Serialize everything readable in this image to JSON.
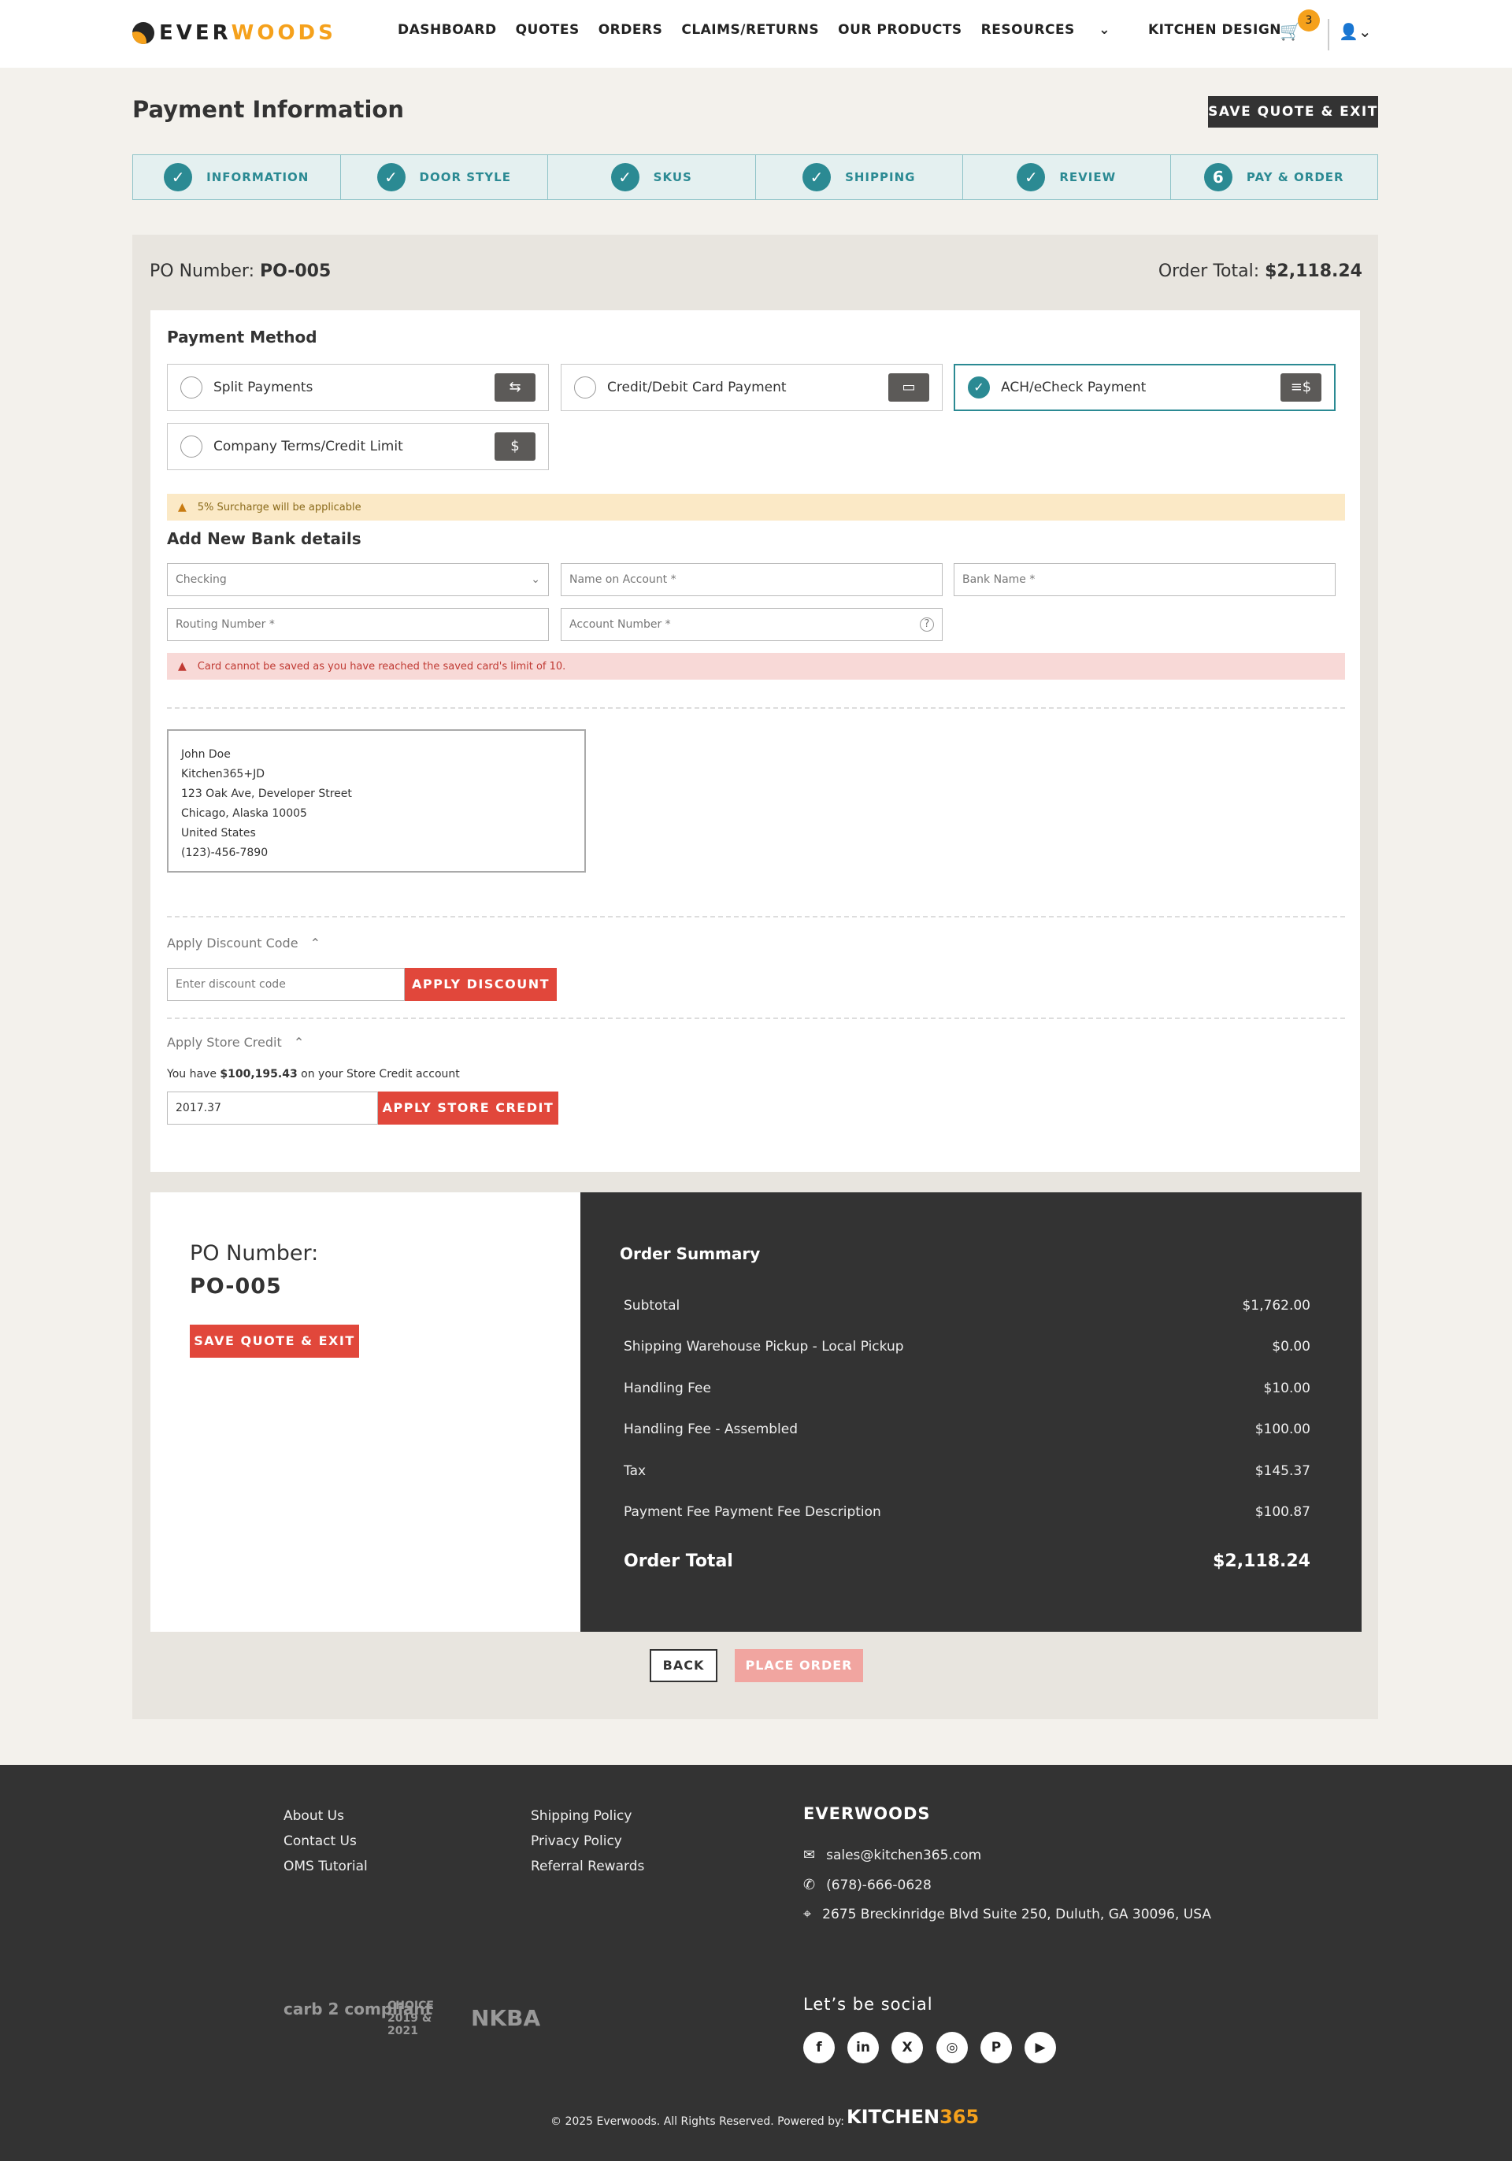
{
  "brand": {
    "name_a": "EVER",
    "name_b": "WOODS"
  },
  "nav": {
    "items": [
      "DASHBOARD",
      "QUOTES",
      "ORDERS",
      "CLAIMS/RETURNS",
      "OUR PRODUCTS",
      "RESOURCES",
      "KITCHEN DESIGN"
    ],
    "resources_caret": "⌄",
    "cart_count": "3"
  },
  "page": {
    "title": "Payment Information",
    "save_exit": "SAVE QUOTE & EXIT"
  },
  "steps": [
    {
      "mark": "✓",
      "label": "INFORMATION"
    },
    {
      "mark": "✓",
      "label": "DOOR STYLE"
    },
    {
      "mark": "✓",
      "label": "SKUS"
    },
    {
      "mark": "✓",
      "label": "SHIPPING"
    },
    {
      "mark": "✓",
      "label": "REVIEW"
    },
    {
      "mark": "6",
      "label": "PAY & ORDER"
    }
  ],
  "order": {
    "po_label": "PO Number:",
    "po_value": "PO-005",
    "total_label": "Order Total:",
    "total_value": "$2,118.24"
  },
  "payment": {
    "heading": "Payment Method",
    "methods": [
      {
        "label": "Split Payments",
        "icon": "split-payments-icon"
      },
      {
        "label": "Credit/Debit Card Payment",
        "icon": "credit-card-icon"
      },
      {
        "label": "ACH/eCheck Payment",
        "icon": "check-icon",
        "selected": true
      },
      {
        "label": "Company Terms/Credit Limit",
        "icon": "credit-limit-icon"
      }
    ],
    "surcharge": "5% Surcharge will be applicable",
    "bank_heading": "Add New Bank details",
    "account_type": "Checking",
    "name_ph": "Name on Account *",
    "bank_ph": "Bank Name *",
    "routing_ph": "Routing Number *",
    "account_ph": "Account Number *",
    "error": "Card cannot be saved as you have reached the saved card's limit of 10."
  },
  "address": [
    "John Doe",
    "Kitchen365+JD",
    "123 Oak Ave, Developer Street",
    "Chicago, Alaska 10005",
    "United States",
    "(123)-456-7890"
  ],
  "discount": {
    "toggle": "Apply Discount Code",
    "placeholder": "Enter discount code",
    "button": "APPLY DISCOUNT"
  },
  "store_credit": {
    "toggle": "Apply Store Credit",
    "note_pre": "You have ",
    "note_amount": "$100,195.43",
    "note_post": " on your Store Credit account",
    "value": "2017.37",
    "button": "APPLY STORE CREDIT"
  },
  "summary": {
    "po_label": "PO Number:",
    "po_value": "PO-005",
    "save_exit": "SAVE QUOTE & EXIT",
    "title": "Order Summary",
    "rows": [
      {
        "label": "Subtotal",
        "value": "$1,762.00"
      },
      {
        "label": "Shipping Warehouse Pickup - Local Pickup",
        "value": "$0.00"
      },
      {
        "label": "Handling Fee",
        "value": "$10.00"
      },
      {
        "label": "Handling Fee - Assembled",
        "value": "$100.00"
      },
      {
        "label": "Tax",
        "value": "$145.37"
      },
      {
        "label": "Payment Fee Payment Fee Description",
        "value": "$100.87"
      }
    ],
    "total_label": "Order Total",
    "total_value": "$2,118.24"
  },
  "actions": {
    "back": "BACK",
    "place": "PLACE ORDER"
  },
  "footer": {
    "col1": [
      "About Us",
      "Contact Us",
      "OMS Tutorial"
    ],
    "col2": [
      "Shipping Policy",
      "Privacy Policy",
      "Referral Rewards"
    ],
    "company": "EVERWOODS",
    "email": "sales@kitchen365.com",
    "phone": "(678)-666-0628",
    "address": "2675 Breckinridge Blvd Suite 250, Duluth, GA 30096, USA",
    "social_heading": "Let’s be social",
    "social": [
      "f",
      "in",
      "X",
      "◎",
      "P",
      "▶"
    ],
    "badges": [
      "carb 2 compliant",
      "CHOICE 2019 & 2021",
      "NKBA"
    ],
    "copyright": "© 2025 Everwoods. All Rights Reserved.   Powered by:",
    "powered_a": "KITCHEN",
    "powered_b": "365"
  }
}
